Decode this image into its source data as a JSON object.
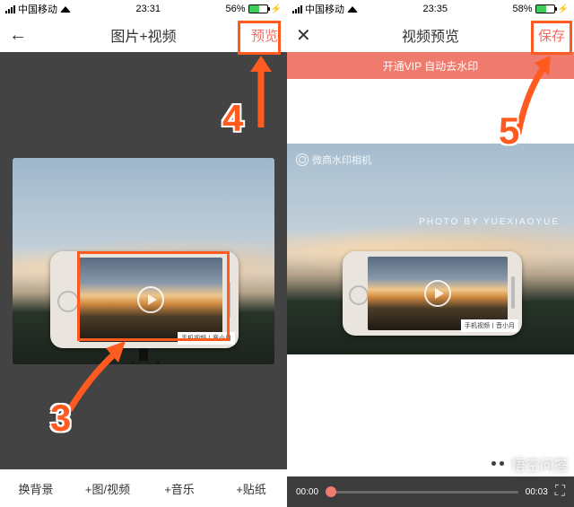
{
  "left": {
    "status": {
      "carrier": "中国移动",
      "time": "23:31",
      "battery_pct": "56%"
    },
    "nav": {
      "title": "图片+视频",
      "action": "预览"
    },
    "phone_wm": "手机视频丨音小月",
    "toolbar": [
      "换背景",
      "+图/视频",
      "+音乐",
      "+贴纸"
    ],
    "anno3": "3",
    "anno4": "4"
  },
  "right": {
    "status": {
      "carrier": "中国移动",
      "time": "23:35",
      "battery_pct": "58%"
    },
    "nav": {
      "title": "视频预览",
      "action": "保存"
    },
    "vip": "开通VIP 自动去水印",
    "watermark_app": "微商水印相机",
    "credit": "PHOTO BY YUEXIAOYUE",
    "phone_wm": "手机视频丨音小月",
    "progress": {
      "cur": "00:00",
      "total": "00:03"
    },
    "anno5": "5",
    "wk": "悟空问答"
  }
}
